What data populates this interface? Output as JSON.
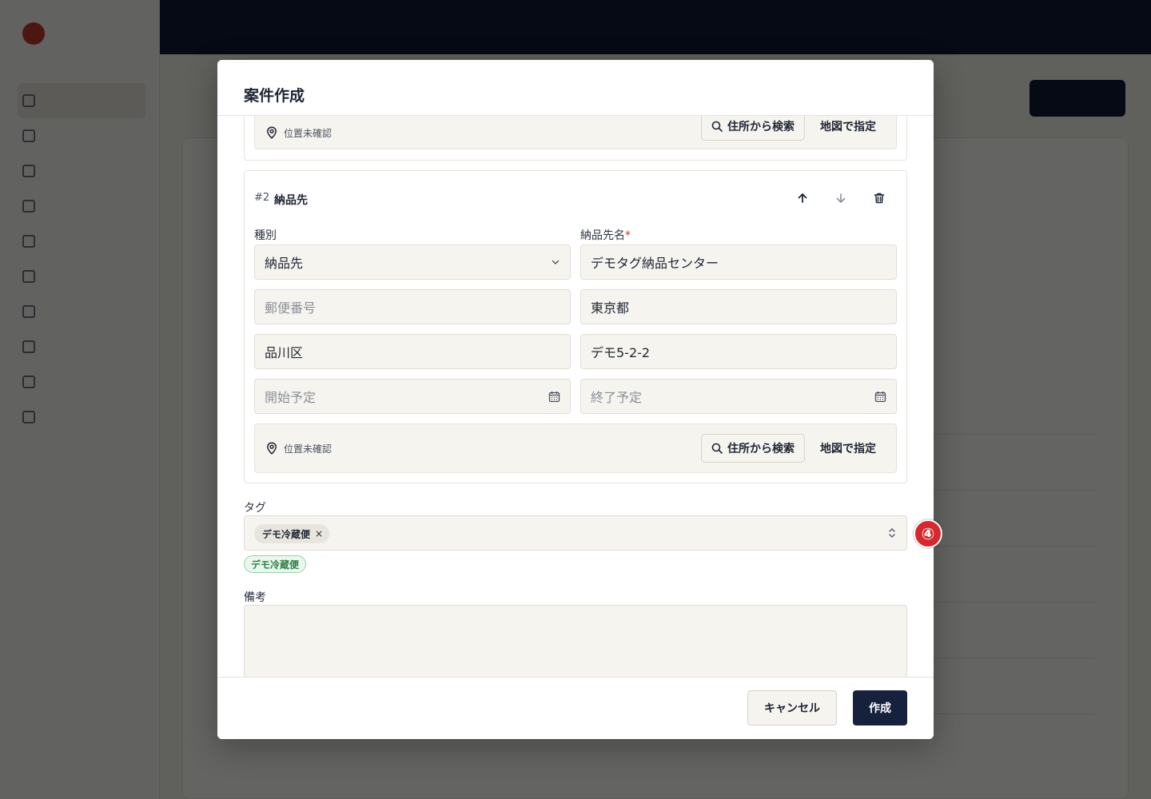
{
  "modal": {
    "title": "案件作成",
    "prev_stop": {
      "location_status": "位置未確認",
      "search_label": "住所から検索",
      "map_label": "地図で指定"
    },
    "stop": {
      "number": "#2",
      "name": "納品先",
      "type_label": "種別",
      "type_value": "納品先",
      "dest_name_label": "納品先名",
      "required_mark": "*",
      "dest_name_value": "デモタグ納品センター",
      "postal_placeholder": "郵便番号",
      "prefecture_value": "東京都",
      "city_value": "品川区",
      "address_value": "デモ5-2-2",
      "start_placeholder": "開始予定",
      "end_placeholder": "終了予定",
      "location_status": "位置未確認",
      "search_label": "住所から検索",
      "map_label": "地図で指定"
    },
    "tags": {
      "label": "タグ",
      "selected_chip": "デモ冷蔵便",
      "chip_remove": "×",
      "badge": "デモ冷蔵便"
    },
    "note": {
      "label": "備考",
      "value": ""
    },
    "footer": {
      "cancel_label": "キャンセル",
      "create_label": "作成"
    }
  },
  "annotation": {
    "marker": "④"
  },
  "colors": {
    "primary": "#15213d",
    "danger": "#d32f2f",
    "tag_green": "#2e7d44",
    "overlay": "rgba(0,0,0,0.6)"
  }
}
